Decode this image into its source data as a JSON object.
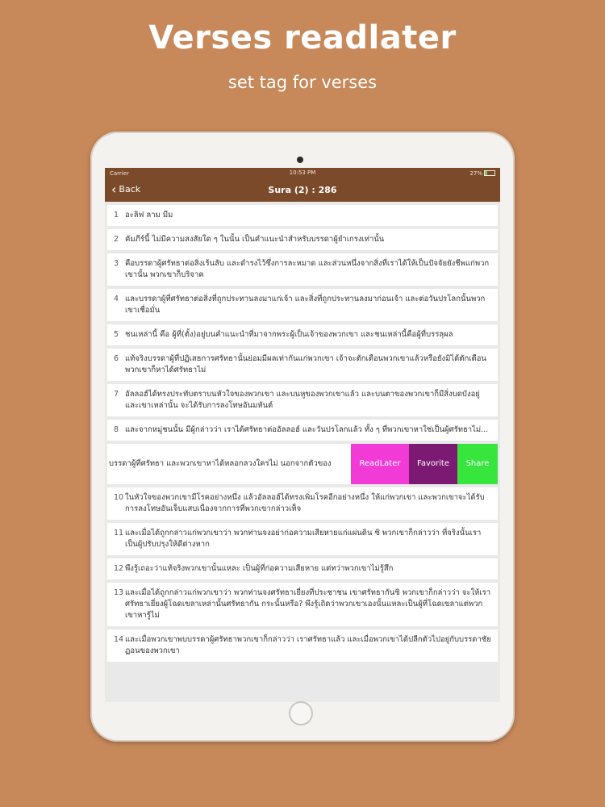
{
  "promo": {
    "headline": "Verses readlater",
    "subline": "set tag for verses"
  },
  "statusbar": {
    "carrier": "Carrier",
    "time": "10:53 PM",
    "battery_text": "27%",
    "battery_level": 0.27
  },
  "navbar": {
    "back_label": "Back",
    "title": "Sura (2) : 286"
  },
  "verses": [
    {
      "num": "1",
      "text": "อะลิฟ ลาม มีม"
    },
    {
      "num": "2",
      "text": "คัมภีร์นี้ ไม่มีความสงสัยใด ๆ ในนั้น เป็นคำแนะนำสำหรับบรรดาผู้ยำเกรงเท่านั้น"
    },
    {
      "num": "3",
      "text": "คือบรรดาผู้ศรัทธาต่อสิ่งเร้นลับ และดำรงไว้ซึ่งการละหมาด และส่วนหนึ่งจากสิ่งที่เราได้ให้เป็นปัจจัยยังชีพแก่พวกเขานั้น พวกเขาก็บริจาค"
    },
    {
      "num": "4",
      "text": "และบรรดาผู้ที่ศรัทธาต่อสิ่งที่ถูกประทานลงมาแก่เจ้า และสิ่งที่ถูกประทานลงมาก่อนเจ้า และต่อวันปรโลกนั้นพวกเขาเชื่อมั่น"
    },
    {
      "num": "5",
      "text": "ชนเหล่านี้ คือ ผู้ที่(ตั้ง)อยู่บนคำแนะนำที่มาจากพระผู้เป็นเจ้าของพวกเขา และชนเหล่านี้คือผู้ที่บรรลุผล"
    },
    {
      "num": "6",
      "text": "แท้จริงบรรดาผู้ที่ปฏิเสธการศรัทธานั้นย่อมมีผลเท่ากันแก่พวกเขา เจ้าจะตักเตือนพวกเขาแล้วหรือยังมิได้ตักเตือนพวกเขาก็หาได้ศรัทธาไม่"
    },
    {
      "num": "7",
      "text": "อัลลอฮ์ได้ทรงประทับตราบนหัวใจของพวกเขา และบนหูของพวกเขาแล้ว และบนตาของพวกเขาก็มีสิ่งบดบังอยู่และเขาเหล่านั้น จะได้รับการลงโทษอันมหันต์"
    },
    {
      "num": "8",
      "text": "และจากหมู่ชนนั้น มีผู้กล่าวว่า เราได้ศรัทธาต่ออัลลอฮ์ และวันปรโลกแล้ว ทั้ง ๆ ที่พวกเขาหาใช่เป็นผู้ศรัทธาไม่..."
    }
  ],
  "swipe_row": {
    "text": "บรรดาผู้ที่ศรัทธา และพวกเขาหาได้หลอกลวงใครไม่ นอกจากตัวของ",
    "actions": [
      {
        "label": "ReadLater",
        "color": "#f23bd6"
      },
      {
        "label": "Favorite",
        "color": "#7c1a73"
      },
      {
        "label": "Share",
        "color": "#37e53d"
      }
    ]
  },
  "verses_after": [
    {
      "num": "10",
      "text": "ในหัวใจของพวกเขามีโรคอย่างหนึ่ง แล้วอัลลอฮ์ได้ทรงเพิ่มโรคอีกอย่างหนึ่ง ให้แก่พวกเขา และพวกเขาจะได้รับการลงโทษอันเจ็บแสบเนื่องจากการที่พวกเขากล่าวเท็จ"
    },
    {
      "num": "11",
      "text": "และเมื่อได้ถูกกล่าวแก่พวกเขาว่า พวกท่านจงอย่าก่อความเสียหายแก่แผ่นดิน ซิ พวกเขาก็กล่าวว่า ที่จริงนั้นเราเป็นผู้ปรับปรุงให้ดีต่างหาก"
    },
    {
      "num": "12",
      "text": "พึงรู้เถอะว่าแท้จริงพวกเขานั้นแหละ เป็นผู้ที่ก่อความเสียหาย แต่ทว่าพวกเขาไม่รู้สึก"
    },
    {
      "num": "13",
      "text": "และเมื่อได้ถูกกล่าวแก่พวกเขาว่า พวกท่านจงศรัทธาเยี่ยงที่ประชาชน เขาศรัทธากันซิ พวกเขาก็กล่าวว่า จะให้เราศรัทธาเยี่ยงผู้โฉดเขลาเหล่านั้นศรัทธากัน กระนั้นหรือ? พึงรู้เถิดว่าพวกเขาเองนั้นแหละเป็นผู้ที่โฉดเขลาแต่พวกเขาหารู้ไม่"
    },
    {
      "num": "14",
      "text": "และเมื่อพวกเขาพบบรรดาผู้ศรัทธาพวกเขาก็กล่าวว่า เราศรัทธาแล้ว และเมื่อพวกเขาได้ปลีกตัวไปอยู่กับบรรดาชัยฏอนของพวกเขา"
    }
  ]
}
